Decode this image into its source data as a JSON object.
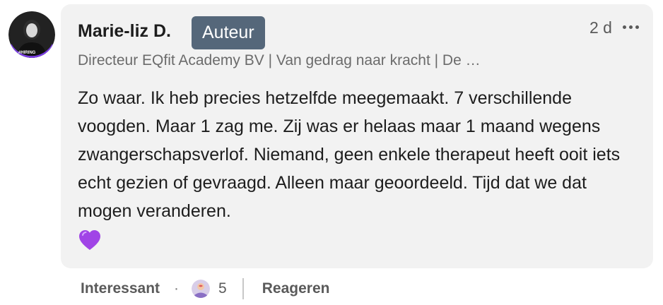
{
  "comment": {
    "author": {
      "name": "Marie-liz D.",
      "badge": "Auteur",
      "headline": "Directeur EQfit Academy BV | Van gedrag naar kracht | De …",
      "avatar_icon": "profile-photo-hiring",
      "avatar_ring_text": "#HIRING",
      "avatar_ring_color": "#7b3fe4"
    },
    "timestamp": "2 d",
    "more_icon": "ellipsis-icon",
    "text": "Zo waar. Ik heb precies hetzelfde meegemaakt. 7 verschillende voogden. Maar 1 zag me. Zij was er helaas maar 1 maand wegens zwangerschapsverlof. Niemand, geen enkele therapeut heeft ooit iets echt gezien of gevraagd. Alleen maar geoordeeld. Tijd dat we dat mogen veranderen.",
    "emoji": "💜",
    "emoji_icon": "purple-heart-icon"
  },
  "actions": {
    "like_label": "Interessant",
    "separator": "·",
    "reaction_icon": "insightful-reaction-icon",
    "reaction_count": "5",
    "reply_label": "Reageren"
  },
  "colors": {
    "bubble_bg": "#f2f2f2",
    "badge_bg": "#55677a",
    "badge_text": "#ffffff",
    "text_primary": "#1d1d1d",
    "text_secondary": "#6b6b6b",
    "emoji_purple": "#a044e6"
  }
}
